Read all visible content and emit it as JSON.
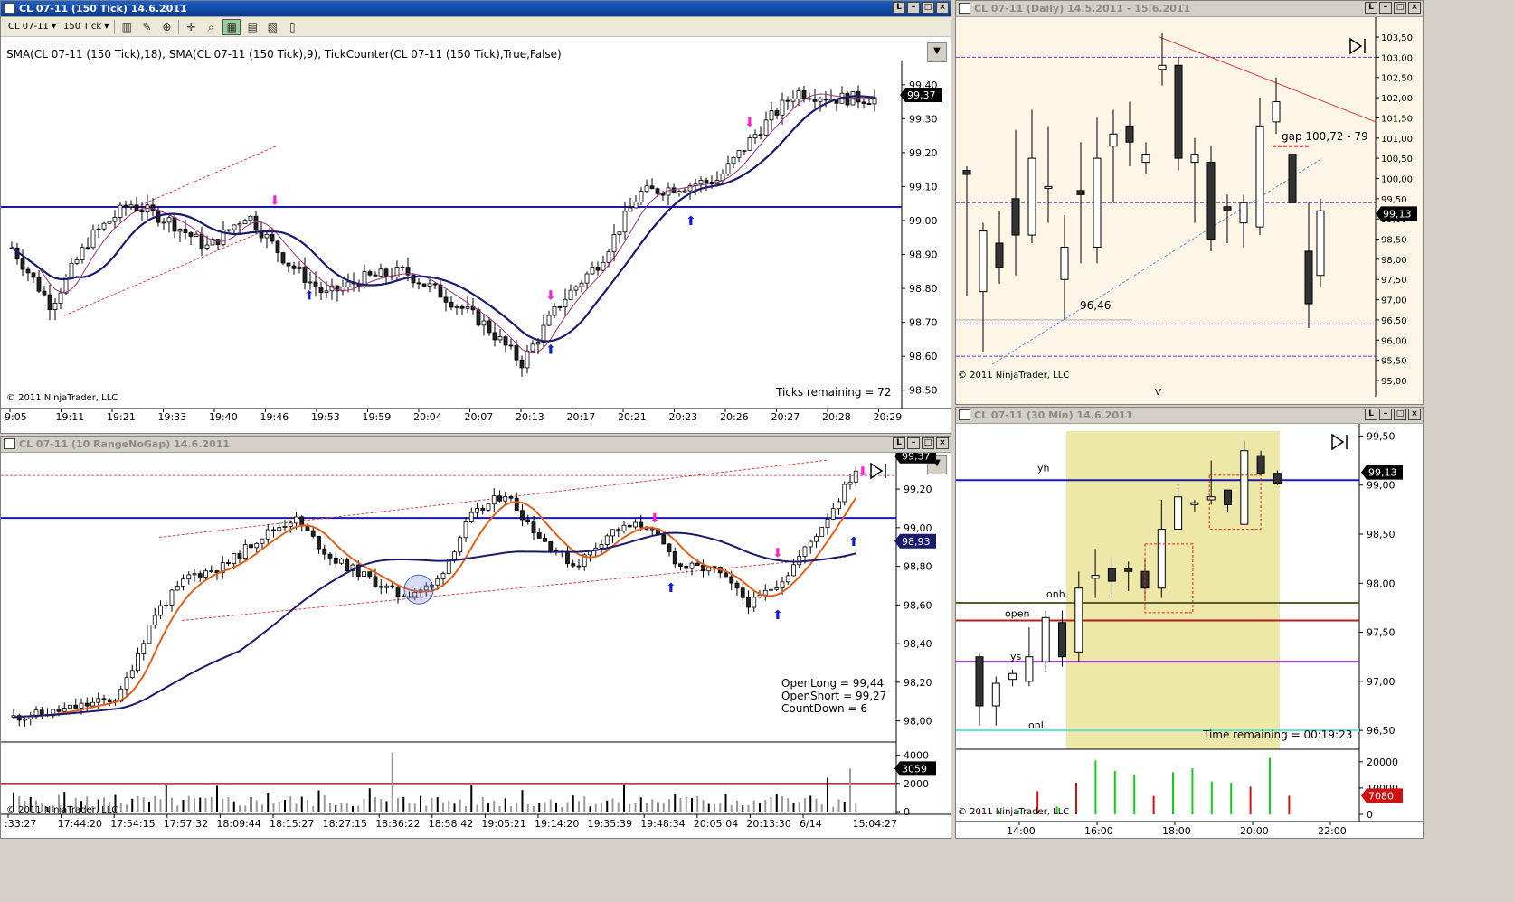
{
  "colors": {
    "bull": "#ffffff",
    "bear": "#222222",
    "axis_bg": "#ffffff",
    "daily_bg": "#fdf5e6",
    "session_fill": "#ede8a8",
    "hline_blue": "#1a1aa8",
    "ma_navy": "#1a1a6e",
    "ma_thin": "#a0307a",
    "ma_orange": "#e0601a"
  },
  "win1": {
    "title": "CL 07-11 (150 Tick)  14.6.2011",
    "toolbar": {
      "instrument": "CL 07-11",
      "interval": "150 Tick",
      "icons": [
        "bar-type-icon",
        "draw-pencil-icon",
        "zoom-icon",
        "crosshair-icon",
        "chart-style-icon",
        "data-box-icon",
        "properties-icon",
        "templates-icon"
      ]
    },
    "indicator_label": "SMA(CL 07-11 (150 Tick),18), SMA(CL 07-11 (150 Tick),9), TickCounter(CL 07-11 (150 Tick),True,False)",
    "copyright": "© 2011 NinjaTrader, LLC",
    "ticks_remaining": "Ticks remaining = 72",
    "last_price": "99,37",
    "y_labels": [
      "99,40",
      "99,30",
      "99,20",
      "99,10",
      "99,00",
      "98,90",
      "98,80",
      "98,70",
      "98,60",
      "98,50"
    ],
    "x_labels": [
      "9:05",
      "19:11",
      "19:21",
      "19:33",
      "19:40",
      "19:46",
      "19:53",
      "19:59",
      "20:04",
      "20:07",
      "20:13",
      "20:17",
      "20:21",
      "20:23",
      "20:26",
      "20:27",
      "20:28",
      "20:29"
    ]
  },
  "win2": {
    "title": "CL 07-11 (Daily)  14.5.2011 - 15.6.2011",
    "copyright": "© 2011 NinjaTrader, LLC",
    "gap_label": "gap 100,72 - 79",
    "low_label": "96,46",
    "last_price": "99,13",
    "x_labels": [
      "V"
    ],
    "y_labels": [
      "103,50",
      "103,00",
      "102,50",
      "102,00",
      "101,50",
      "101,00",
      "100,50",
      "100,00",
      "99,50",
      "99,00",
      "98,50",
      "98,00",
      "97,50",
      "97,00",
      "96,50",
      "96,00",
      "95,50",
      "95,00"
    ]
  },
  "win3": {
    "title": "CL 07-11 (10 RangeNoGap)  14.6.2011",
    "copyright": "© 2011 NinjaTrader, LLC",
    "open_long": "OpenLong = 99,44",
    "open_short": "OpenShort = 99,27",
    "countdown": "CountDown = 6",
    "last_price": "99,37",
    "ma_value": "98,93",
    "volume_last": "3059",
    "y_labels": [
      "99,20",
      "99,00",
      "98,80",
      "98,60",
      "98,40",
      "98,20",
      "98,00"
    ],
    "vol_labels": [
      "4000",
      "2000",
      "0"
    ],
    "x_labels": [
      ":33:27",
      "17:44:20",
      "17:54:15",
      "17:57:32",
      "18:09:44",
      "18:15:27",
      "18:27:15",
      "18:36:22",
      "18:58:42",
      "19:05:21",
      "19:14:20",
      "19:35:39",
      "19:48:34",
      "20:05:04",
      "20:13:30",
      "6/14",
      "15:04:27"
    ]
  },
  "win4": {
    "title": "CL 07-11 (30 Min)  14.6.2011",
    "copyright": "© 2011 NinjaTrader, LLC",
    "time_remaining": "Time remaining = 00:19:23",
    "last_price": "99,13",
    "volume_last": "7080",
    "level_labels": [
      "yh",
      "onh",
      "open",
      "ys",
      "onl"
    ],
    "y_labels": [
      "99,50",
      "99,00",
      "98,50",
      "98,00",
      "97,50",
      "97,00",
      "96,50"
    ],
    "vol_labels": [
      "20000",
      "10000",
      "0"
    ],
    "x_labels": [
      "14:00",
      "16:00",
      "18:00",
      "20:00",
      "22:00"
    ]
  }
}
